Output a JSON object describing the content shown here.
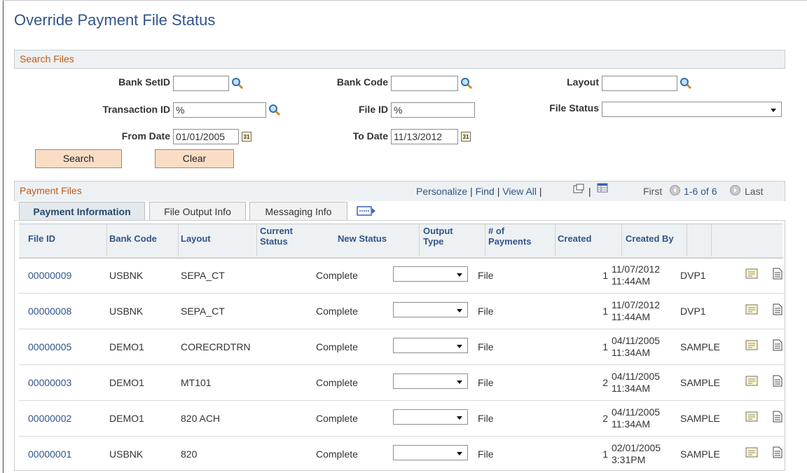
{
  "page": {
    "title": "Override Payment File Status"
  },
  "search": {
    "section_title": "Search Files",
    "bank_setid": {
      "label": "Bank SetID",
      "value": ""
    },
    "bank_code": {
      "label": "Bank Code",
      "value": ""
    },
    "layout": {
      "label": "Layout",
      "value": ""
    },
    "transaction_id": {
      "label": "Transaction ID",
      "value": "%"
    },
    "file_id": {
      "label": "File ID",
      "value": "%"
    },
    "file_status": {
      "label": "File Status",
      "value": ""
    },
    "from_date": {
      "label": "From Date",
      "value": "01/01/2005"
    },
    "to_date": {
      "label": "To Date",
      "value": "11/13/2012"
    },
    "search_button": "Search",
    "clear_button": "Clear"
  },
  "grid": {
    "title": "Payment Files",
    "personalize": "Personalize",
    "find": "Find",
    "view_all": "View All",
    "sep": "|",
    "first": "First",
    "range": "1-6 of 6",
    "last": "Last",
    "tabs": [
      {
        "label": "Payment Information",
        "active": true
      },
      {
        "label": "File Output Info",
        "active": false
      },
      {
        "label": "Messaging Info",
        "active": false
      }
    ],
    "columns": {
      "file_id": "File ID",
      "bank_code": "Bank Code",
      "layout": "Layout",
      "current_status_1": "Current",
      "current_status_2": "Status",
      "new_status": "New Status",
      "output_type_1": "Output",
      "output_type_2": "Type",
      "num_payments_1": "# of",
      "num_payments_2": "Payments",
      "created": "Created",
      "created_by": "Created By"
    },
    "rows": [
      {
        "file_id": "00000009",
        "bank_code": "USBNK",
        "layout": "SEPA_CT",
        "status": "Complete",
        "new_status": "",
        "output": "File",
        "payments": "1",
        "created_date": "11/07/2012",
        "created_time": "11:44AM",
        "created_by": "DVP1"
      },
      {
        "file_id": "00000008",
        "bank_code": "USBNK",
        "layout": "SEPA_CT",
        "status": "Complete",
        "new_status": "",
        "output": "File",
        "payments": "1",
        "created_date": "11/07/2012",
        "created_time": "11:44AM",
        "created_by": "DVP1"
      },
      {
        "file_id": "00000005",
        "bank_code": "DEMO1",
        "layout": "CORECRDTRN",
        "status": "Complete",
        "new_status": "",
        "output": "File",
        "payments": "1",
        "created_date": "04/11/2005",
        "created_time": "11:34AM",
        "created_by": "SAMPLE"
      },
      {
        "file_id": "00000003",
        "bank_code": "DEMO1",
        "layout": "MT101",
        "status": "Complete",
        "new_status": "",
        "output": "File",
        "payments": "2",
        "created_date": "04/11/2005",
        "created_time": "11:34AM",
        "created_by": "SAMPLE"
      },
      {
        "file_id": "00000002",
        "bank_code": "DEMO1",
        "layout": "820 ACH",
        "status": "Complete",
        "new_status": "",
        "output": "File",
        "payments": "2",
        "created_date": "04/11/2005",
        "created_time": "11:34AM",
        "created_by": "SAMPLE"
      },
      {
        "file_id": "00000001",
        "bank_code": "USBNK",
        "layout": "820",
        "status": "Complete",
        "new_status": "",
        "output": "File",
        "payments": "1",
        "created_date": "02/01/2005",
        "created_time": "3:31PM",
        "created_by": "SAMPLE"
      }
    ]
  },
  "icons": {
    "lookup": "magnifier-icon",
    "calendar": "calendar-icon",
    "calendar_text": "31",
    "row_note": "note-icon",
    "row_doc": "document-icon"
  }
}
